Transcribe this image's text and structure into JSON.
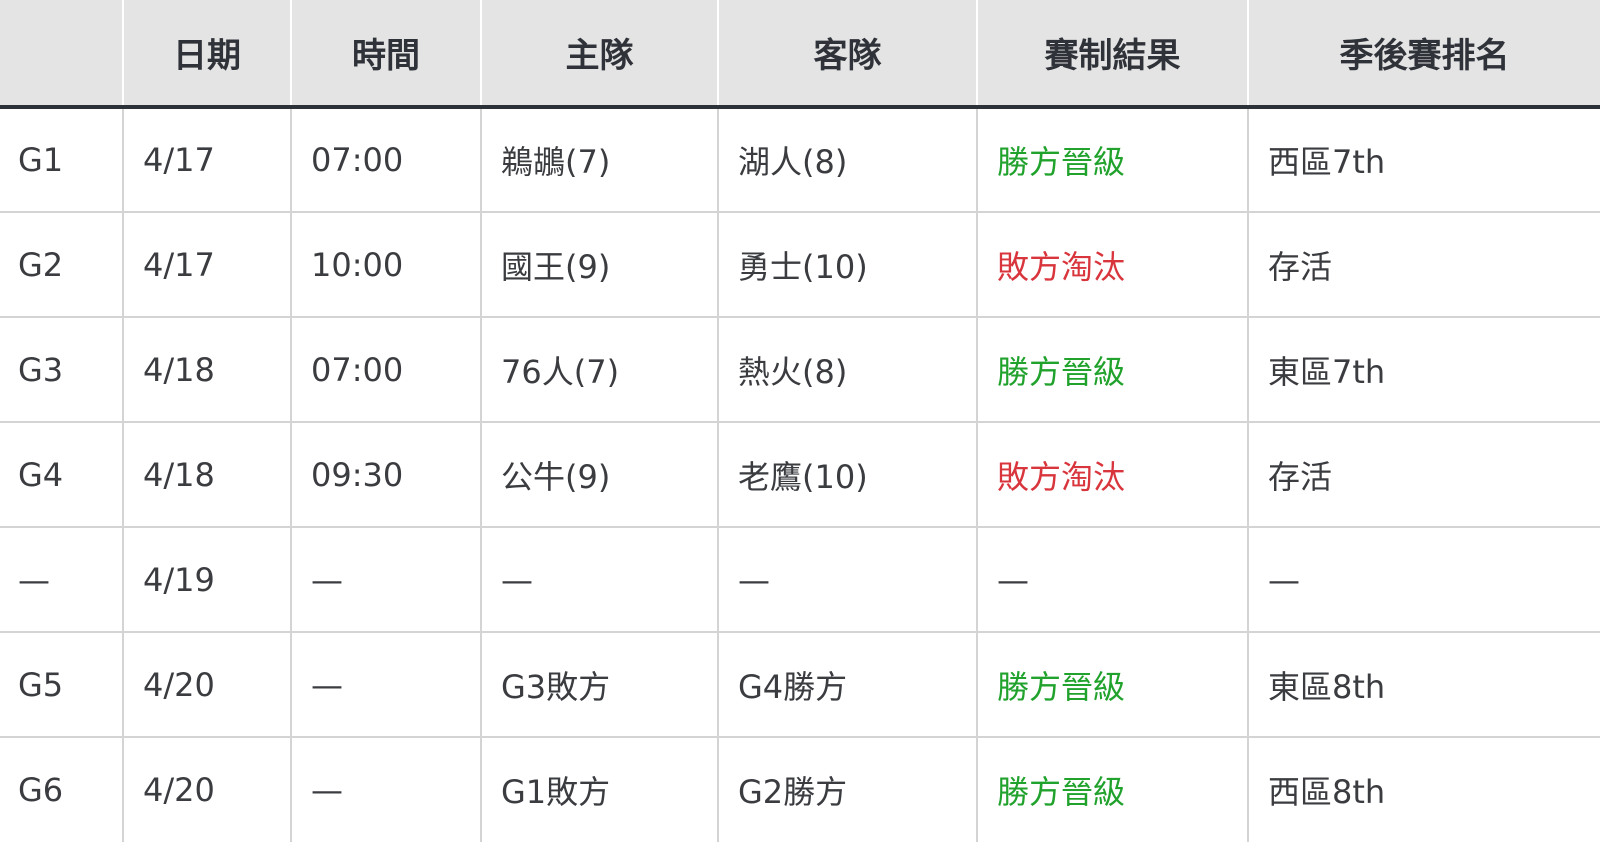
{
  "colors": {
    "win": "#21a22d",
    "lose": "#d8353c",
    "header_bg": "#e4e4e4",
    "header_rule": "#2d3238",
    "text": "#3a3c40"
  },
  "table": {
    "headers": [
      "",
      "日期",
      "時間",
      "主隊",
      "客隊",
      "賽制結果",
      "季後賽排名"
    ],
    "rows": [
      {
        "game": "G1",
        "date": "4/17",
        "time": "07:00",
        "home": "鵜鶘(7)",
        "away": "湖人(8)",
        "result": "勝方晉級",
        "result_type": "win",
        "rank": "西區7th"
      },
      {
        "game": "G2",
        "date": "4/17",
        "time": "10:00",
        "home": "國王(9)",
        "away": "勇士(10)",
        "result": "敗方淘汰",
        "result_type": "lose",
        "rank": "存活"
      },
      {
        "game": "G3",
        "date": "4/18",
        "time": "07:00",
        "home": "76人(7)",
        "away": "熱火(8)",
        "result": "勝方晉級",
        "result_type": "win",
        "rank": "東區7th"
      },
      {
        "game": "G4",
        "date": "4/18",
        "time": "09:30",
        "home": "公牛(9)",
        "away": "老鷹(10)",
        "result": "敗方淘汰",
        "result_type": "lose",
        "rank": "存活"
      },
      {
        "game": "—",
        "date": "4/19",
        "time": "—",
        "home": "—",
        "away": "—",
        "result": "—",
        "result_type": "none",
        "rank": "—"
      },
      {
        "game": "G5",
        "date": "4/20",
        "time": "—",
        "home": "G3敗方",
        "away": "G4勝方",
        "result": "勝方晉級",
        "result_type": "win",
        "rank": "東區8th"
      },
      {
        "game": "G6",
        "date": "4/20",
        "time": "—",
        "home": "G1敗方",
        "away": "G2勝方",
        "result": "勝方晉級",
        "result_type": "win",
        "rank": "西區8th"
      }
    ]
  }
}
